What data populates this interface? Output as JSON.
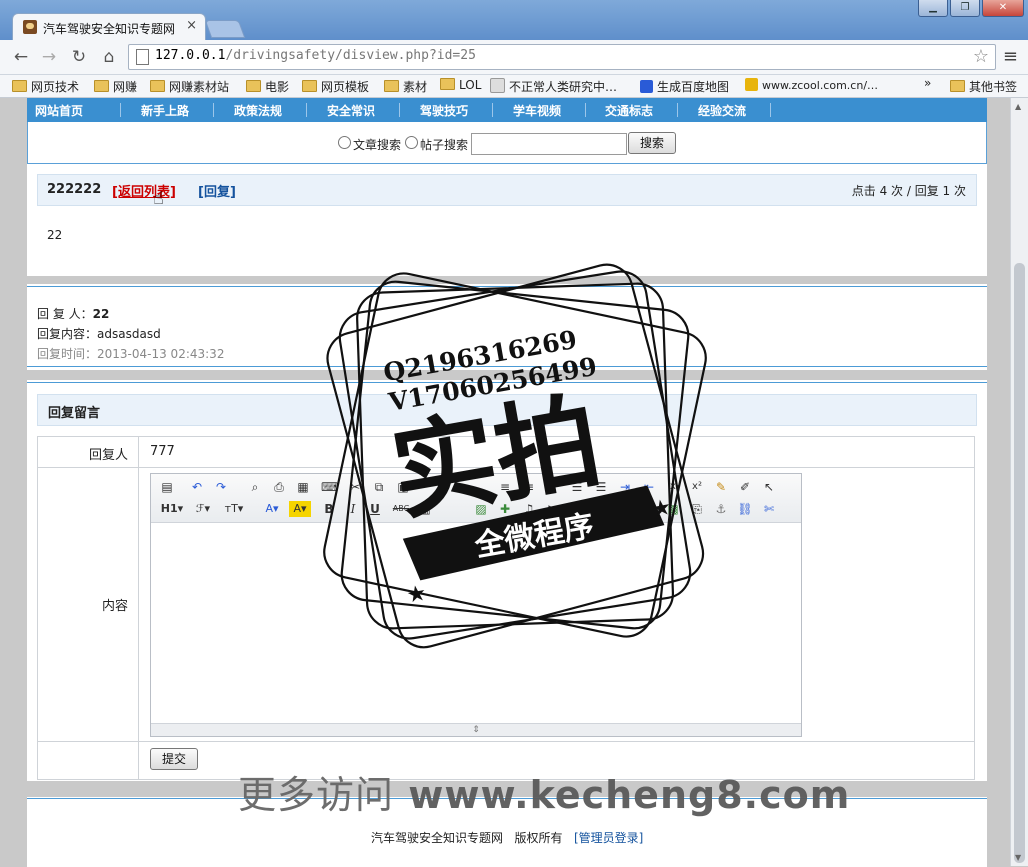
{
  "browser": {
    "tab_title": "汽车驾驶安全知识专题网",
    "tab_close": "×",
    "url_host": "127.0.0.1",
    "url_path": "/drivingsafety/disview.php?id=25",
    "window_buttons": [
      "▁",
      "❐",
      "✕"
    ],
    "bookmarks": [
      "网页技术",
      "网赚",
      "网赚素材站",
      "电影",
      "网页模板",
      "素材",
      "LOL",
      "不正常人类研究中…",
      "生成百度地图",
      "www.zcool.com.cn/…",
      "»",
      "其他书签"
    ]
  },
  "nav": {
    "items": [
      "网站首页",
      "新手上路",
      "政策法规",
      "安全常识",
      "驾驶技巧",
      "学车视频",
      "交通标志",
      "经验交流"
    ]
  },
  "search": {
    "option_article": "文章搜索",
    "option_post": "帖子搜索",
    "value": "",
    "button": "搜索"
  },
  "post": {
    "title": "222222",
    "back_link": "[返回列表]",
    "reply_link": "[回复]",
    "stats": "点击 4 次 / 回复 1 次",
    "content": "22"
  },
  "reply": {
    "author_label": "回 复 人：",
    "author": "22",
    "content_label": "回复内容：",
    "content": "adsasdasd",
    "time": "回复时间：2013-04-13 02:43:32"
  },
  "form": {
    "title": "回复留言",
    "replier_label": "回复人",
    "replier_value": "777",
    "content_label": "内容",
    "submit": "提交",
    "toolbar_row2": [
      "H1▾",
      "ℱ▾",
      "ᴛT▾",
      "A▾",
      "A▾",
      "B",
      "I",
      "U",
      "ABC"
    ]
  },
  "footer": {
    "site": "汽车驾驶安全知识专题网",
    "rights": "版权所有",
    "admin_link": "[管理员登录]"
  },
  "overlay": {
    "qq": "Q2196316269",
    "vx": "V17060256499",
    "stamp_big": "实拍",
    "stamp_ribbon": "全微程序",
    "watermark_cn": "更多访问",
    "watermark_url": "www.kecheng8.com"
  }
}
